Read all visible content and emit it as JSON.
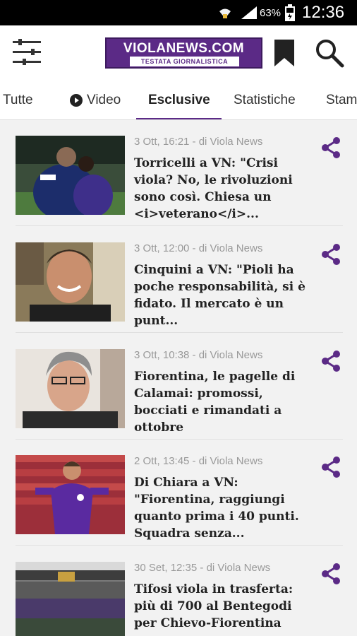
{
  "status_bar": {
    "battery_percent": "63%",
    "time": "12:36",
    "icons": [
      "wifi-icon",
      "signal-icon",
      "battery-icon"
    ]
  },
  "app_bar": {
    "logo_main": "VIOLANEWS.COM",
    "logo_sub": "TESTATA GIORNALISTICA",
    "icons": [
      "menu-icon",
      "bookmark-icon",
      "search-icon"
    ],
    "accent_color": "#5b2a86"
  },
  "tabs": [
    {
      "label": "Tutte",
      "active": false
    },
    {
      "label": "Video",
      "active": false,
      "icon": "play-icon"
    },
    {
      "label": "Esclusive",
      "active": true
    },
    {
      "label": "Statistiche",
      "active": false
    },
    {
      "label": "Stam",
      "active": false
    }
  ],
  "articles": [
    {
      "meta": "3 Ott, 16:21 - di Viola News",
      "title": "Torricelli a VN: \"Crisi viola? No, le rivoluzioni sono così. Chiesa un <i>veterano</i>..."
    },
    {
      "meta": "3 Ott, 12:00 - di Viola News",
      "title": "Cinquini a VN: \"Pioli ha poche responsabilità, si è fidato. Il mercato è un punt..."
    },
    {
      "meta": "3 Ott, 10:38 - di Viola News",
      "title": "Fiorentina, le pagelle di Calamai: promossi, bocciati e rimandati a ottobre"
    },
    {
      "meta": "2 Ott, 13:45 - di Viola News",
      "title": "Di Chiara a VN: \"Fiorentina, raggiungi quanto prima i 40 punti. Squadra senza..."
    },
    {
      "meta": "30 Set, 12:35 - di Viola News",
      "title": "Tifosi viola in trasferta: più di 700 al Bentegodi per Chievo-Fiorentina"
    }
  ]
}
